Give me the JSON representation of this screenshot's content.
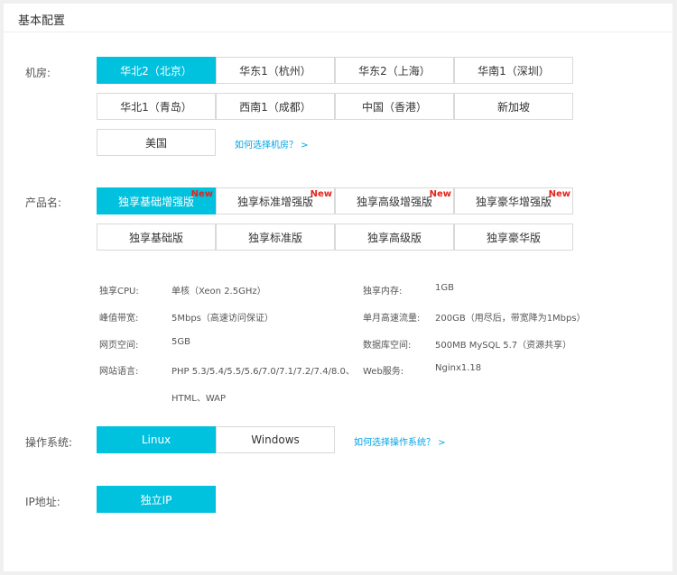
{
  "panel": {
    "title": "基本配置"
  },
  "region": {
    "label": "机房:",
    "options": [
      "华北2（北京）",
      "华东1（杭州）",
      "华东2（上海）",
      "华南1（深圳）",
      "华北1（青岛）",
      "西南1（成都）",
      "中国（香港）",
      "新加坡",
      "美国"
    ],
    "selected_index": 0,
    "help": "如何选择机房？ >"
  },
  "product": {
    "label": "产品名:",
    "options": [
      "独享基础增强版",
      "独享标准增强版",
      "独享高级增强版",
      "独享豪华增强版",
      "独享基础版",
      "独享标准版",
      "独享高级版",
      "独享豪华版"
    ],
    "new_tag": "New",
    "selected_index": 0
  },
  "specs": [
    {
      "label": "独享CPU:",
      "value": "单核（Xeon 2.5GHz）"
    },
    {
      "label": "独享内存:",
      "value": "1GB"
    },
    {
      "label": "峰值带宽:",
      "value": "5Mbps（高速访问保证）"
    },
    {
      "label": "单月高速流量:",
      "value": "200GB（用尽后，带宽降为1Mbps）"
    },
    {
      "label": "网页空间:",
      "value": "5GB"
    },
    {
      "label": "数据库空间:",
      "value": "500MB MySQL 5.7（资源共享）"
    },
    {
      "label": "网站语言:",
      "value": "PHP 5.3/5.4/5.5/5.6/7.0/7.1/7.2/7.4/8.0、",
      "value2": "HTML、WAP"
    },
    {
      "label": "Web服务:",
      "value": "Nginx1.18"
    }
  ],
  "os": {
    "label": "操作系统:",
    "options": [
      "Linux",
      "Windows"
    ],
    "selected_index": 0,
    "help": "如何选择操作系统？ >"
  },
  "ip": {
    "label": "IP地址:",
    "options": [
      "独立IP"
    ],
    "selected_index": 0
  },
  "colors": {
    "accent": "#00c1de",
    "new_tag": "#e5231c",
    "link": "#00a4e6"
  }
}
